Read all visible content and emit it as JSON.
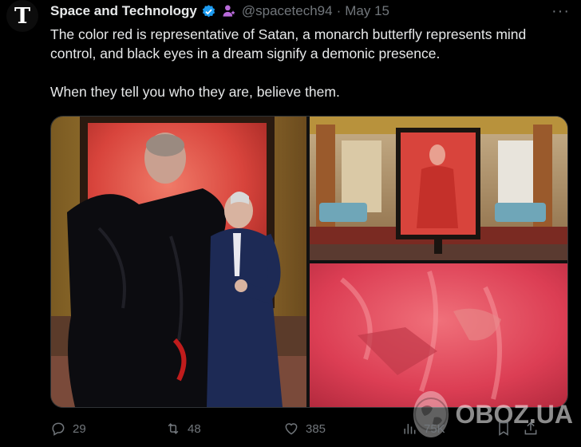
{
  "author": {
    "avatar_letter": "T",
    "name": "Space and Technology",
    "handle": "@spacetech94",
    "separator": "·",
    "date": "May 15"
  },
  "more_label": "···",
  "tweet": {
    "line1": "The color red is representative of Satan, a monarch butterfly represents mind control, and black eyes in a dream signify a demonic presence.",
    "line2": "When they tell you who they are, believe them."
  },
  "stats": {
    "replies": "29",
    "retweets": "48",
    "likes": "385",
    "views": "75K"
  },
  "watermark": {
    "text": "OBOZ.UA"
  },
  "colors": {
    "background": "#000000",
    "text": "#e7e9ea",
    "muted": "#71767b",
    "verified": "#1d9bf0",
    "affiliate": "#b86ad9"
  },
  "icons": {
    "verified": "verified-badge-icon",
    "affiliate": "affiliate-badge-icon",
    "reply": "reply-icon",
    "retweet": "retweet-icon",
    "like": "heart-icon",
    "views": "views-chart-icon",
    "bookmark": "bookmark-icon",
    "share": "share-icon"
  }
}
